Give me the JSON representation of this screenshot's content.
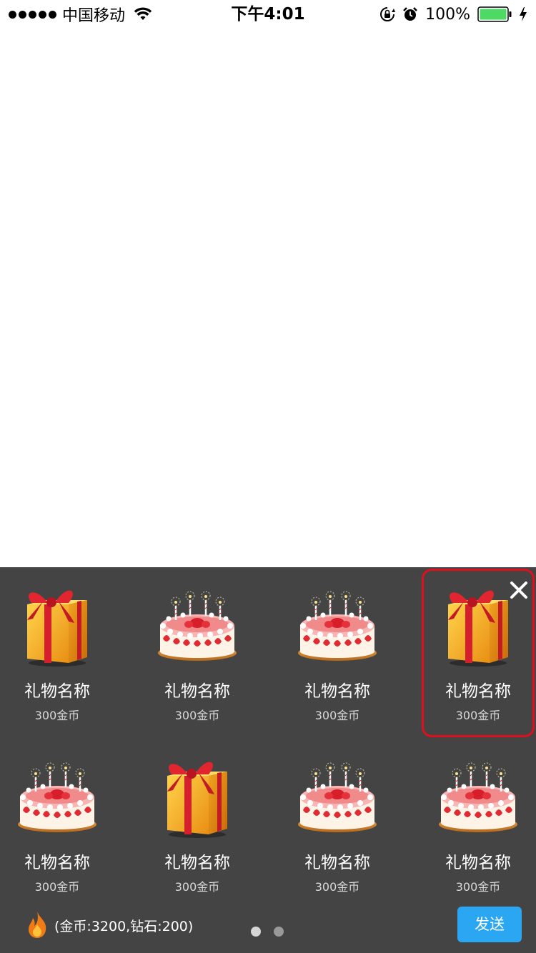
{
  "status_bar": {
    "carrier": "中国移动",
    "time": "下午4:01",
    "battery": "100%",
    "signal_bars": 5,
    "icons": [
      "wifi-icon",
      "rotation-lock-icon",
      "alarm-icon",
      "battery-icon",
      "charging-icon"
    ]
  },
  "gift_panel": {
    "selected_index": 3,
    "accent_color": "#e00f1d",
    "items": [
      {
        "icon": "gift-box-icon",
        "name": "礼物名称",
        "price": "300金币"
      },
      {
        "icon": "birthday-cake-icon",
        "name": "礼物名称",
        "price": "300金币"
      },
      {
        "icon": "birthday-cake-icon",
        "name": "礼物名称",
        "price": "300金币"
      },
      {
        "icon": "gift-box-icon",
        "name": "礼物名称",
        "price": "300金币"
      },
      {
        "icon": "birthday-cake-icon",
        "name": "礼物名称",
        "price": "300金币"
      },
      {
        "icon": "gift-box-icon",
        "name": "礼物名称",
        "price": "300金币"
      },
      {
        "icon": "birthday-cake-icon",
        "name": "礼物名称",
        "price": "300金币"
      },
      {
        "icon": "birthday-cake-icon",
        "name": "礼物名称",
        "price": "300金币"
      }
    ]
  },
  "footer": {
    "balance": "(金币:3200,钻石:200)",
    "send_label": "发送",
    "send_color": "#2aa6f2",
    "page_count": 2,
    "current_page": 1
  }
}
